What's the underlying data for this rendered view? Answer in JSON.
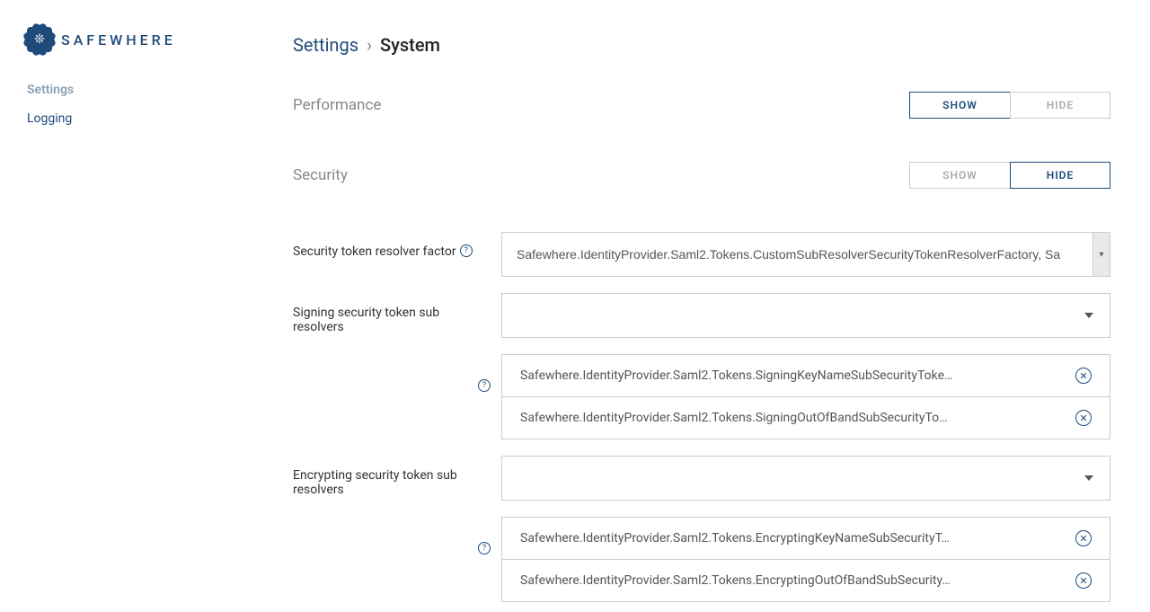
{
  "logo_text": "SAFEWHERE",
  "nav": {
    "settings": "Settings",
    "logging": "Logging"
  },
  "breadcrumb": {
    "parent": "Settings",
    "sep": "›",
    "current": "System"
  },
  "sections": {
    "performance": {
      "title": "Performance",
      "show": "SHOW",
      "hide": "HIDE"
    },
    "security": {
      "title": "Security",
      "show": "SHOW",
      "hide": "HIDE"
    }
  },
  "fields": {
    "resolver_factor": {
      "label": "Security token resolver factor",
      "value": "Safewhere.IdentityProvider.Saml2.Tokens.CustomSubResolverSecurityTokenResolverFactory, Sa"
    },
    "signing": {
      "label": "Signing security token sub resolvers",
      "items": [
        "Safewhere.IdentityProvider.Saml2.Tokens.SigningKeyNameSubSecurityToke…",
        "Safewhere.IdentityProvider.Saml2.Tokens.SigningOutOfBandSubSecurityTo…"
      ]
    },
    "encrypting": {
      "label": "Encrypting security token sub resolvers",
      "items": [
        "Safewhere.IdentityProvider.Saml2.Tokens.EncryptingKeyNameSubSecurityT…",
        "Safewhere.IdentityProvider.Saml2.Tokens.EncryptingOutOfBandSubSecurity…"
      ]
    }
  }
}
